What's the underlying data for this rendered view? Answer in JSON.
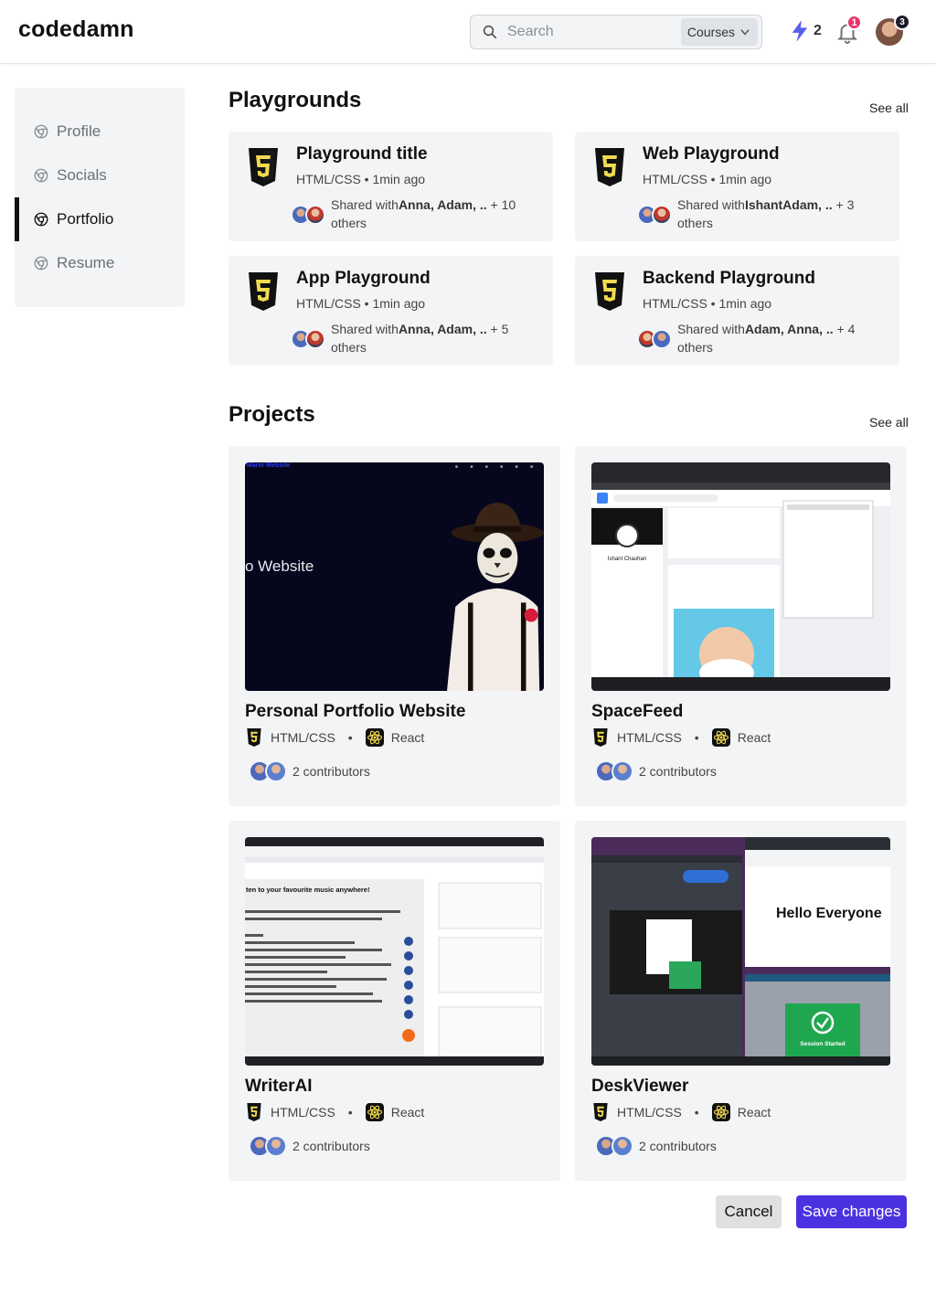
{
  "header": {
    "logo": "codedamn",
    "search_placeholder": "Search",
    "search_scope": "Courses",
    "streak_count": "2",
    "notification_count": "1",
    "profile_badge_count": "3"
  },
  "sidebar": {
    "items": [
      {
        "label": "Profile",
        "active": false
      },
      {
        "label": "Socials",
        "active": false
      },
      {
        "label": "Portfolio",
        "active": true
      },
      {
        "label": "Resume",
        "active": false
      }
    ]
  },
  "playgrounds": {
    "title": "Playgrounds",
    "see_all": "See all",
    "cards": [
      {
        "title": "Playground title",
        "meta": "HTML/CSS • 1min ago",
        "shared_prefix": "Shared with",
        "shared_names": "Anna, Adam, ..",
        "shared_suffix": " + 10 others"
      },
      {
        "title": "Web Playground",
        "meta": "HTML/CSS • 1min ago",
        "shared_prefix": "Shared with",
        "shared_names": "IshantAdam, ..",
        "shared_suffix": " + 3 others"
      },
      {
        "title": "App Playground",
        "meta": "HTML/CSS • 1min ago",
        "shared_prefix": "Shared with",
        "shared_names": "Anna, Adam, ..",
        "shared_suffix": " + 5 others"
      },
      {
        "title": "Backend Playground",
        "meta": "HTML/CSS • 1min ago",
        "shared_prefix": "Shared with",
        "shared_names": "Adam, Anna, ..",
        "shared_suffix": " + 4 others"
      }
    ]
  },
  "projects": {
    "title": "Projects",
    "see_all": "See all",
    "cards": [
      {
        "title": "Personal Portfolio Website",
        "tech1": "HTML/CSS",
        "tech2": "React",
        "contributors": "2 contributors",
        "thumb_text": "o Website",
        "thumb_brand": "Mario Website"
      },
      {
        "title": "SpaceFeed",
        "tech1": "HTML/CSS",
        "tech2": "React",
        "contributors": "2 contributors",
        "thumb_text": "Ishant Chauhan"
      },
      {
        "title": "WriterAI",
        "tech1": "HTML/CSS",
        "tech2": "React",
        "contributors": "2 contributors",
        "thumb_text": "ten to your favourite music anywhere!"
      },
      {
        "title": "DeskViewer",
        "tech1": "HTML/CSS",
        "tech2": "React",
        "contributors": "2 contributors",
        "thumb_text": "Hello Everyone",
        "thumb_status": "Session Started"
      }
    ]
  },
  "actions": {
    "cancel": "Cancel",
    "save": "Save changes"
  },
  "colors": {
    "accent": "#4b32e0",
    "html5_yellow": "#f0db4f",
    "card_bg": "#f3f4f6",
    "notification": "#e8336b"
  }
}
